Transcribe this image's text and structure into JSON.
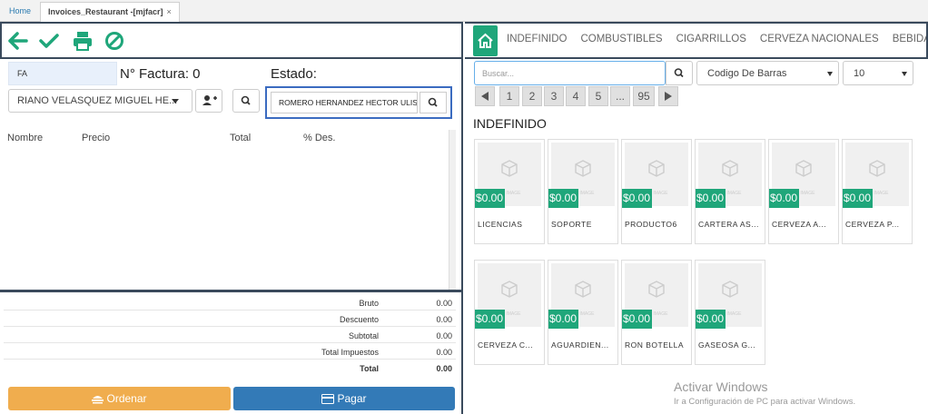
{
  "tabs": {
    "home": "Home",
    "doc_title": "Invoices_Restaurant -[mjfacr]",
    "close": "×"
  },
  "invoice": {
    "doc_type": "FA",
    "factura_label": "N° Factura: 0",
    "estado_label": "Estado:",
    "client": "RIANO VELASQUEZ MIGUEL HE...",
    "seller": "ROMERO HERNANDEZ HECTOR ULISES"
  },
  "items_table": {
    "headers": [
      "Nombre",
      "Precio",
      "Total",
      "% Des."
    ]
  },
  "totals": [
    {
      "label": "Bruto",
      "value": "0.00",
      "bold": false
    },
    {
      "label": "Descuento",
      "value": "0.00",
      "bold": false
    },
    {
      "label": "Subtotal",
      "value": "0.00",
      "bold": false
    },
    {
      "label": "Total Impuestos",
      "value": "0.00",
      "bold": false
    },
    {
      "label": "Total",
      "value": "0.00",
      "bold": true
    }
  ],
  "actions": {
    "ordenar": "Ordenar",
    "pagar": "Pagar"
  },
  "categories": [
    "INDEFINIDO",
    "COMBUSTIBLES",
    "CIGARRILLOS",
    "CERVEZA NACIONALES",
    "BEBIDAS"
  ],
  "search": {
    "placeholder": "Buscar...",
    "field_select": "Codigo De Barras",
    "page_size": "10"
  },
  "pagination": {
    "pages": [
      "1",
      "2",
      "3",
      "4",
      "5",
      "...",
      "95"
    ],
    "current": "1"
  },
  "section_title": "INDEFINIDO",
  "no_image_text": "NO IMAGE",
  "products": [
    {
      "name": "LICENCIAS",
      "price": "$0.00"
    },
    {
      "name": "SOPORTE",
      "price": "$0.00"
    },
    {
      "name": "PRODUCTO6",
      "price": "$0.00"
    },
    {
      "name": "CARTERA AS...",
      "price": "$0.00"
    },
    {
      "name": "CERVEZA A...",
      "price": "$0.00"
    },
    {
      "name": "CERVEZA P...",
      "price": "$0.00"
    },
    {
      "name": "CERVEZA C...",
      "price": "$0.00"
    },
    {
      "name": "AGUARDIEN...",
      "price": "$0.00"
    },
    {
      "name": "RON BOTELLA",
      "price": "$0.00"
    },
    {
      "name": "GASEOSA G...",
      "price": "$0.00"
    }
  ],
  "watermark": {
    "line1": "Activar Windows",
    "line2": "Ir a Configuración de PC para activar Windows."
  },
  "colors": {
    "green": "#1fa67a",
    "orange": "#f0ad4e",
    "blue": "#337ab7",
    "dark_border": "#3a4a5c"
  }
}
